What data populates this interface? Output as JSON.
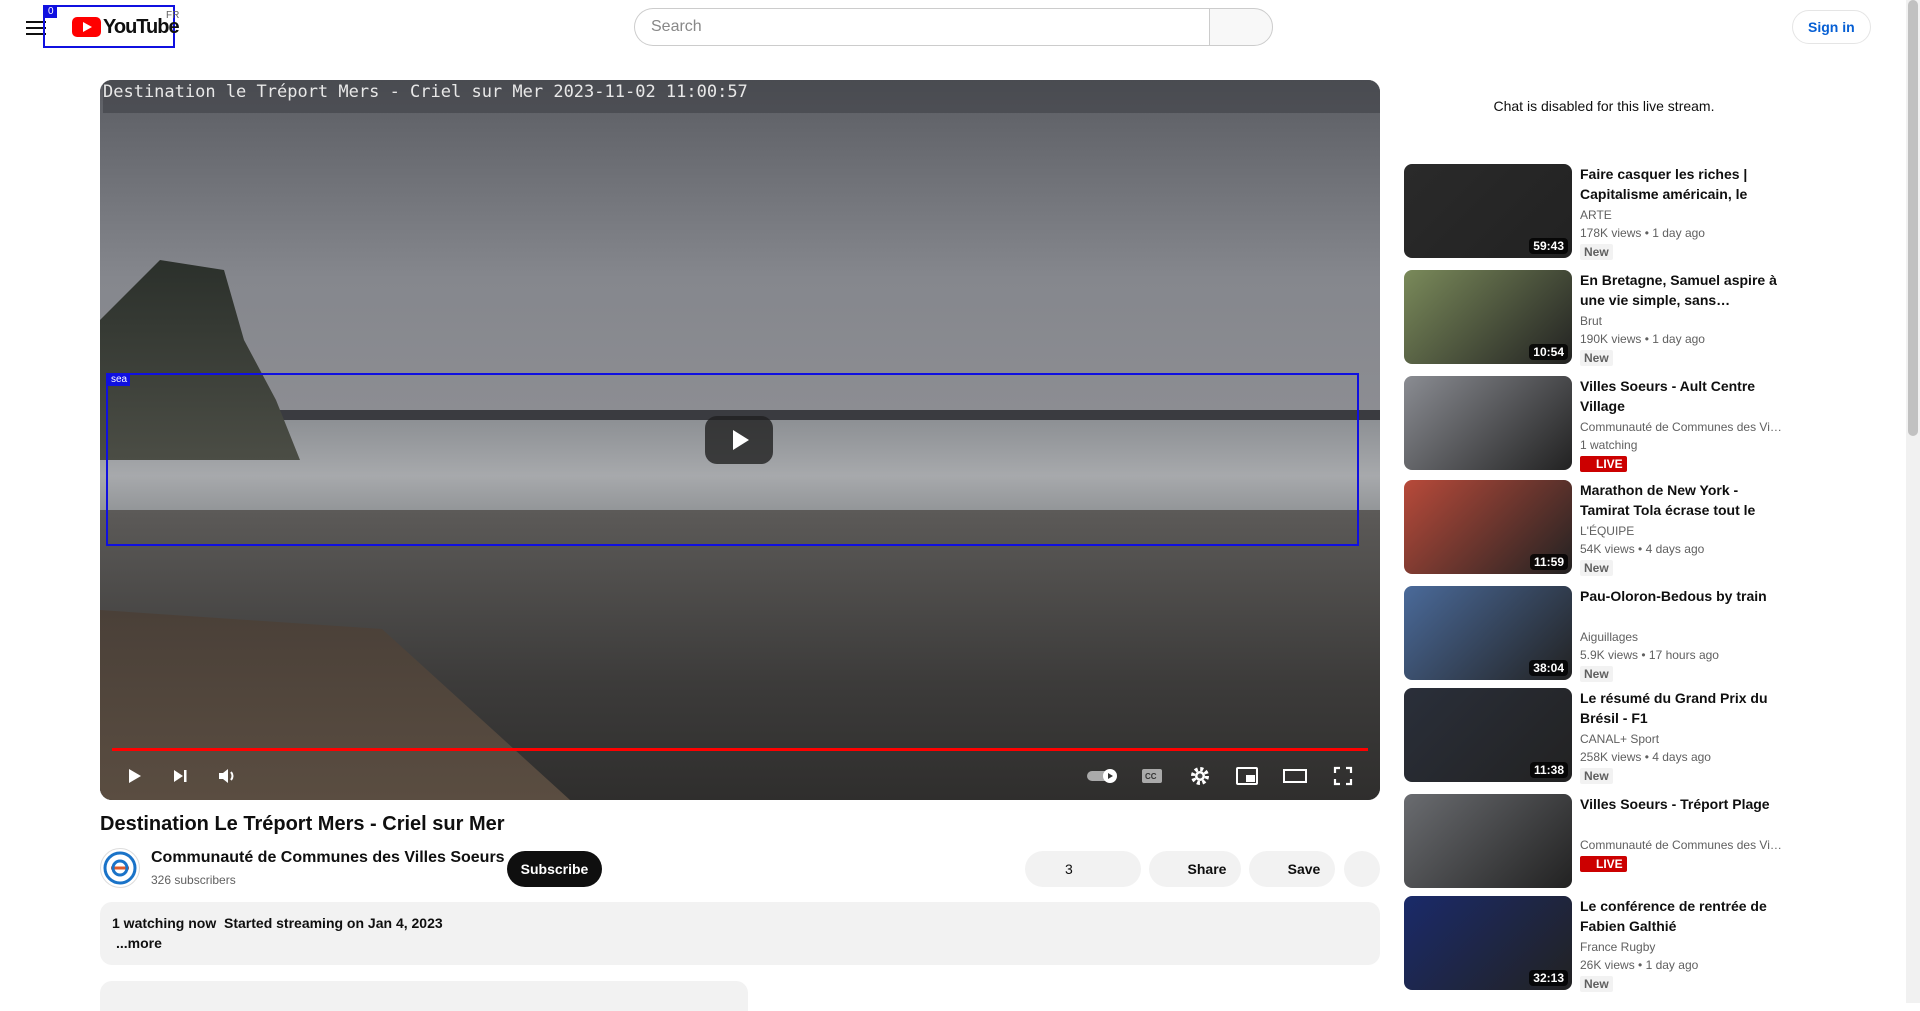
{
  "header": {
    "logo_text": "YouTube",
    "country_code": "FR",
    "search_placeholder": "Search",
    "sign_in": "Sign in"
  },
  "annotations": {
    "logo_box_label": "0",
    "sea_box_label": "sea"
  },
  "player": {
    "overlay_text": "Destination le Tréport Mers - Criel sur Mer 2023-11-02 11:00:57",
    "progress_fraction": 1.0,
    "accent_color": "#ff0000"
  },
  "video": {
    "title": "Destination Le Tréport Mers - Criel sur Mer",
    "channel_name": "Communauté de Communes des Villes Soeurs",
    "subscribers": "326 subscribers",
    "subscribe_label": "Subscribe",
    "like_count": "3",
    "share_label": "Share",
    "save_label": "Save",
    "description_line": "1 watching now  Started streaming on Jan 4, 2023",
    "more_label": "...more"
  },
  "sidebar": {
    "chat_disabled": "Chat is disabled for this live stream.",
    "recommendations": [
      {
        "title": "Faire casquer les riches | Capitalisme américain, le culte…",
        "channel": "ARTE",
        "views": "178K views",
        "age": "1 day ago",
        "badge": "New",
        "duration": "59:43",
        "thumb_color": "#2a2a2a"
      },
      {
        "title": "En Bretagne, Samuel aspire à une vie simple, sans…",
        "channel": "Brut",
        "views": "190K views",
        "age": "1 day ago",
        "badge": "New",
        "duration": "10:54",
        "thumb_color": "#7a8a5a"
      },
      {
        "title": "Villes Soeurs - Ault Centre Village",
        "channel": "Communauté de Communes des Vil…",
        "views": "1 watching",
        "age": "",
        "badge": "LIVE",
        "duration": "",
        "thumb_color": "#8a8c92"
      },
      {
        "title": "Marathon de New York - Tamirat Tola écrase tout le monde ave…",
        "channel": "L'ÉQUIPE",
        "views": "54K views",
        "age": "4 days ago",
        "badge": "New",
        "duration": "11:59",
        "thumb_color": "#b84a3a"
      },
      {
        "title": "Pau-Oloron-Bedous by train",
        "channel": "Aiguillages",
        "views": "5.9K views",
        "age": "17 hours ago",
        "badge": "New",
        "duration": "38:04",
        "thumb_color": "#4a6a9a"
      },
      {
        "title": "Le résumé du Grand Prix du Brésil - F1",
        "channel": "CANAL+ Sport",
        "views": "258K views",
        "age": "4 days ago",
        "badge": "New",
        "duration": "11:38",
        "thumb_color": "#2a2f3a"
      },
      {
        "title": "Villes Soeurs - Tréport Plage",
        "channel": "Communauté de Communes des Vil…",
        "views": "",
        "age": "",
        "badge": "LIVE",
        "duration": "",
        "thumb_color": "#6a6c70"
      },
      {
        "title": "Le conférence de rentrée de Fabien Galthié",
        "channel": "France Rugby",
        "views": "26K views",
        "age": "1 day ago",
        "badge": "New",
        "duration": "32:13",
        "thumb_color": "#1a2a6a"
      }
    ]
  }
}
